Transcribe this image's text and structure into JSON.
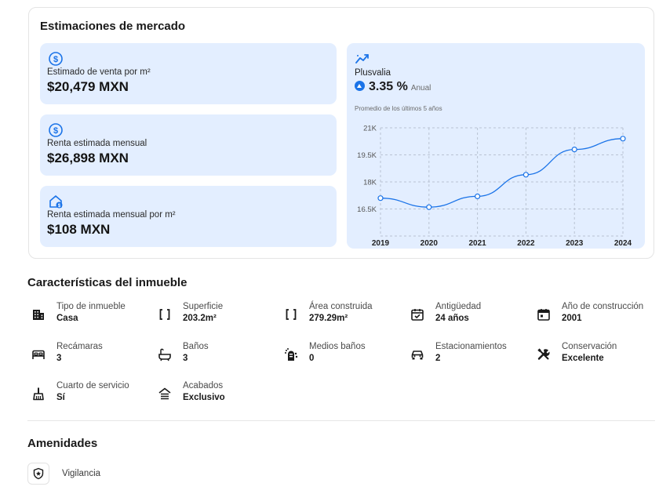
{
  "market": {
    "title": "Estimaciones de mercado",
    "sale_per_m2": {
      "label": "Estimado de venta por m²",
      "value": "$20,479 MXN"
    },
    "monthly_rent": {
      "label": "Renta estimada mensual",
      "value": "$26,898 MXN"
    },
    "monthly_rent_per_m2": {
      "label": "Renta estimada mensual por m²",
      "value": "$108 MXN"
    },
    "plusvalia": {
      "title": "Plusvalia",
      "percent": "3.35 %",
      "period": "Anual",
      "subtitle": "Promedio de los últimos 5 años"
    },
    "accent_color": "#1a73e8",
    "card_bg": "#e3eeff"
  },
  "chart_data": {
    "type": "line",
    "title": "",
    "x": [
      "2019",
      "2020",
      "2021",
      "2022",
      "2023",
      "2024"
    ],
    "y_ticks": [
      "21K",
      "19.5K",
      "18K",
      "16.5K"
    ],
    "y_tick_values": [
      21000,
      19500,
      18000,
      16500
    ],
    "ylim": [
      15000,
      21000
    ],
    "series": [
      {
        "values": [
          17100,
          16600,
          17200,
          18400,
          19800,
          20400
        ]
      }
    ],
    "grid": true,
    "line_color": "#1a73e8"
  },
  "features": {
    "title": "Características del inmueble",
    "items": [
      {
        "label": "Tipo de inmueble",
        "value": "Casa",
        "icon": "building-icon"
      },
      {
        "label": "Superficie",
        "value": "203.2m²",
        "icon": "brackets-icon"
      },
      {
        "label": "Área construida",
        "value": "279.29m²",
        "icon": "brackets-icon"
      },
      {
        "label": "Antigüedad",
        "value": "24 años",
        "icon": "calendar-check-icon"
      },
      {
        "label": "Año de construcción",
        "value": "2001",
        "icon": "calendar-icon"
      },
      {
        "label": "Recámaras",
        "value": "3",
        "icon": "bed-icon"
      },
      {
        "label": "Baños",
        "value": "3",
        "icon": "bathtub-icon"
      },
      {
        "label": "Medios baños",
        "value": "0",
        "icon": "shower-icon"
      },
      {
        "label": "Estacionamientos",
        "value": "2",
        "icon": "car-icon"
      },
      {
        "label": "Conservación",
        "value": "Excelente",
        "icon": "tools-icon"
      },
      {
        "label": "Cuarto de servicio",
        "value": "Sí",
        "icon": "broom-icon"
      },
      {
        "label": "Acabados",
        "value": "Exclusivo",
        "icon": "house-floor-icon"
      }
    ]
  },
  "amenities": {
    "title": "Amenidades",
    "items": [
      {
        "label": "Vigilancia",
        "icon": "shield-star-icon"
      }
    ]
  }
}
